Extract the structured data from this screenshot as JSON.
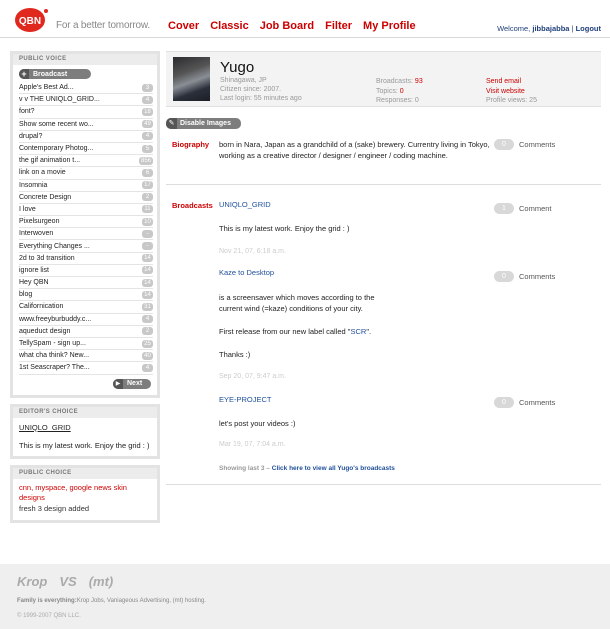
{
  "header": {
    "tagline": "For a better tomorrow.",
    "nav": [
      "Cover",
      "Classic",
      "Job Board",
      "Filter",
      "My Profile"
    ],
    "welcome_prefix": "Welcome,",
    "username": "jibbajabba",
    "logout": "Logout"
  },
  "sidebar": {
    "public_voice_title": "PUBLIC VOICE",
    "broadcast_label": "Broadcast",
    "items": [
      {
        "label": "Apple's Best Ad...",
        "count": "3"
      },
      {
        "label": "v v THE UNIQLO_GRID...",
        "count": "4"
      },
      {
        "label": "font?",
        "count": "18"
      },
      {
        "label": "Show some recent wo...",
        "count": "49"
      },
      {
        "label": "drupal?",
        "count": "4"
      },
      {
        "label": "Contemporary Photog...",
        "count": "5"
      },
      {
        "label": "the gif animation t...",
        "count": "856"
      },
      {
        "label": "link on a movie",
        "count": "6"
      },
      {
        "label": "Insomnia",
        "count": "17"
      },
      {
        "label": "Concrete Design",
        "count": "2"
      },
      {
        "label": "I love",
        "count": "11"
      },
      {
        "label": "Pixelsurgeon",
        "count": "10"
      },
      {
        "label": "Interwoven",
        "count": "-"
      },
      {
        "label": "Everything Changes ...",
        "count": "-"
      },
      {
        "label": "2d to 3d transition",
        "count": "14"
      },
      {
        "label": "ignore list",
        "count": "14"
      },
      {
        "label": "Hey QBN",
        "count": "14"
      },
      {
        "label": "blog",
        "count": "14"
      },
      {
        "label": "Californication",
        "count": "31"
      },
      {
        "label": "www.freeyburbuddy.c...",
        "count": "4"
      },
      {
        "label": "aqueduct design",
        "count": "2"
      },
      {
        "label": "TellySpam - sign up...",
        "count": "25"
      },
      {
        "label": "what cha think? New...",
        "count": "40"
      },
      {
        "label": "1st Seascraper? The...",
        "count": "4"
      }
    ],
    "next_label": "Next",
    "editors_choice_title": "EDITOR'S CHOICE",
    "editors_choice_link": "UNIQLO_GRID",
    "editors_choice_text": "This is my latest work. Enjoy the grid : )",
    "public_choice_title": "PUBLIC CHOICE",
    "public_choice_link": "cnn, myspace, google news skin designs",
    "public_choice_text": "fresh 3 design added"
  },
  "profile": {
    "name": "Yugo",
    "location": "Shinagawa, JP",
    "citizen_since": "Citizen since: 2007.",
    "last_login": "Last login: 55 minutes ago",
    "broadcasts_label": "Broadcasts:",
    "broadcasts_value": "93",
    "topics_label": "Topics:",
    "topics_value": "0",
    "responses_label": "Responses:",
    "responses_value": "0",
    "send_email": "Send email",
    "visit_website": "Visit website",
    "profile_views": "Profile views: 25"
  },
  "disable_images": "Disable Images",
  "biography": {
    "label": "Biography",
    "text": "born in Nara, Japan as a grandchild of a (sake) brewery. Currentry living in Tokyo, working as a creative director / designer / engineer / coding machine.",
    "comment_count": "0",
    "comment_label": "Comments"
  },
  "broadcasts": {
    "label": "Broadcasts",
    "items": [
      {
        "title": "UNIQLO_GRID",
        "text": "This is my latest work. Enjoy the grid : )",
        "date": "Nov 21, 07, 6:18 a.m.",
        "comment_count": "1",
        "comment_label": "Comment"
      },
      {
        "title": "Kaze to Desktop",
        "text1": "is a screensaver which moves according to the current wind (=kaze) conditions of your city.",
        "text2_pre": "First release from our new label called \"",
        "text2_link": "SCR",
        "text2_post": "\".",
        "text3": "Thanks :)",
        "date": "Sep 20, 07, 9:47 a.m.",
        "comment_count": "0",
        "comment_label": "Comments"
      },
      {
        "title": "EYE-PROJECT",
        "text": "let's post your videos :)",
        "date": "Mar 19, 07, 7:04 a.m.",
        "comment_count": "0",
        "comment_label": "Comments"
      }
    ],
    "showing_prefix": "Showing last 3 –",
    "showing_link": "Click here to view all Yugo's broadcasts"
  },
  "footer": {
    "logo1": "Krop",
    "logo2": "VS",
    "logo3": "(mt)",
    "family_label": "Family is everything:",
    "family_text": "Krop Jobs, Vaniageous Advertising, (mt) hosting.",
    "copyright": "© 1999-2007 QBN LLC."
  },
  "colors": {
    "accent": "#cc0000",
    "link": "#1f4f9a",
    "pill": "#7d7d7d"
  }
}
